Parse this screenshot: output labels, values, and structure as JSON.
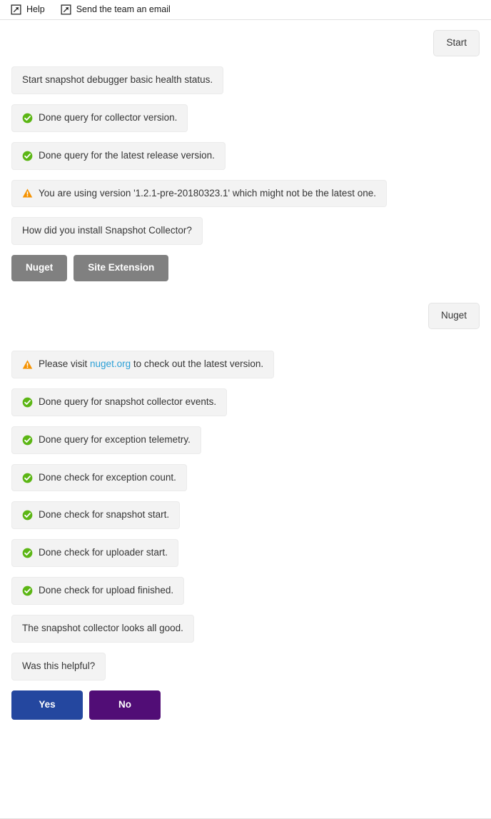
{
  "toolbar": {
    "links": [
      {
        "label": "Help",
        "icon": "external-link-icon"
      },
      {
        "label": "Send the team an email",
        "icon": "external-link-icon"
      }
    ]
  },
  "colors": {
    "bubble_bg": "#f3f3f3",
    "bubble_border": "#ebebeb",
    "gray_button": "#808080",
    "yes_button": "#24479f",
    "no_button": "#510d76",
    "success_green": "#5cb615",
    "warning_orange": "#f59200",
    "link_blue": "#2a9fd6",
    "text": "#363636"
  },
  "conversation": {
    "messages": [
      {
        "id": "m0",
        "side": "right",
        "kind": "user",
        "text": "Start"
      },
      {
        "id": "m1",
        "side": "left",
        "kind": "plain",
        "text": "Start snapshot debugger basic health status."
      },
      {
        "id": "m2",
        "side": "left",
        "kind": "success",
        "icon": "success-check-icon",
        "text": "Done query for collector version."
      },
      {
        "id": "m3",
        "side": "left",
        "kind": "success",
        "icon": "success-check-icon",
        "text": "Done query for the latest release version."
      },
      {
        "id": "m4",
        "side": "left",
        "kind": "warning",
        "icon": "warning-triangle-icon",
        "text": "You are using version '1.2.1-pre-20180323.1' which might not be the latest one."
      },
      {
        "id": "m5",
        "side": "left",
        "kind": "plain",
        "text": "How did you install Snapshot Collector?"
      },
      {
        "id": "m6",
        "side": "right",
        "kind": "user",
        "text": "Nuget"
      },
      {
        "id": "m7",
        "side": "left",
        "kind": "success",
        "icon": "success-check-icon",
        "text": "Done query for snapshot collector events."
      },
      {
        "id": "m8",
        "side": "left",
        "kind": "success",
        "icon": "success-check-icon",
        "text": "Done query for exception telemetry."
      },
      {
        "id": "m9",
        "side": "left",
        "kind": "success",
        "icon": "success-check-icon",
        "text": "Done check for exception count."
      },
      {
        "id": "m10",
        "side": "left",
        "kind": "success",
        "icon": "success-check-icon",
        "text": "Done check for snapshot start."
      },
      {
        "id": "m11",
        "side": "left",
        "kind": "success",
        "icon": "success-check-icon",
        "text": "Done check for uploader start."
      },
      {
        "id": "m12",
        "side": "left",
        "kind": "success",
        "icon": "success-check-icon",
        "text": "Done check for upload finished."
      },
      {
        "id": "m13",
        "side": "left",
        "kind": "plain",
        "text": "The snapshot collector looks all good."
      },
      {
        "id": "m14",
        "side": "left",
        "kind": "plain",
        "text": "Was this helpful?"
      }
    ],
    "nuget_link_message": {
      "icon": "warning-triangle-icon",
      "prefix": "Please visit ",
      "link_text": "nuget.org",
      "suffix": " to check out the latest version."
    },
    "install_choices": [
      {
        "label": "Nuget"
      },
      {
        "label": "Site Extension"
      }
    ],
    "feedback_choices": [
      {
        "label": "Yes",
        "style": "yes"
      },
      {
        "label": "No",
        "style": "no"
      }
    ]
  }
}
